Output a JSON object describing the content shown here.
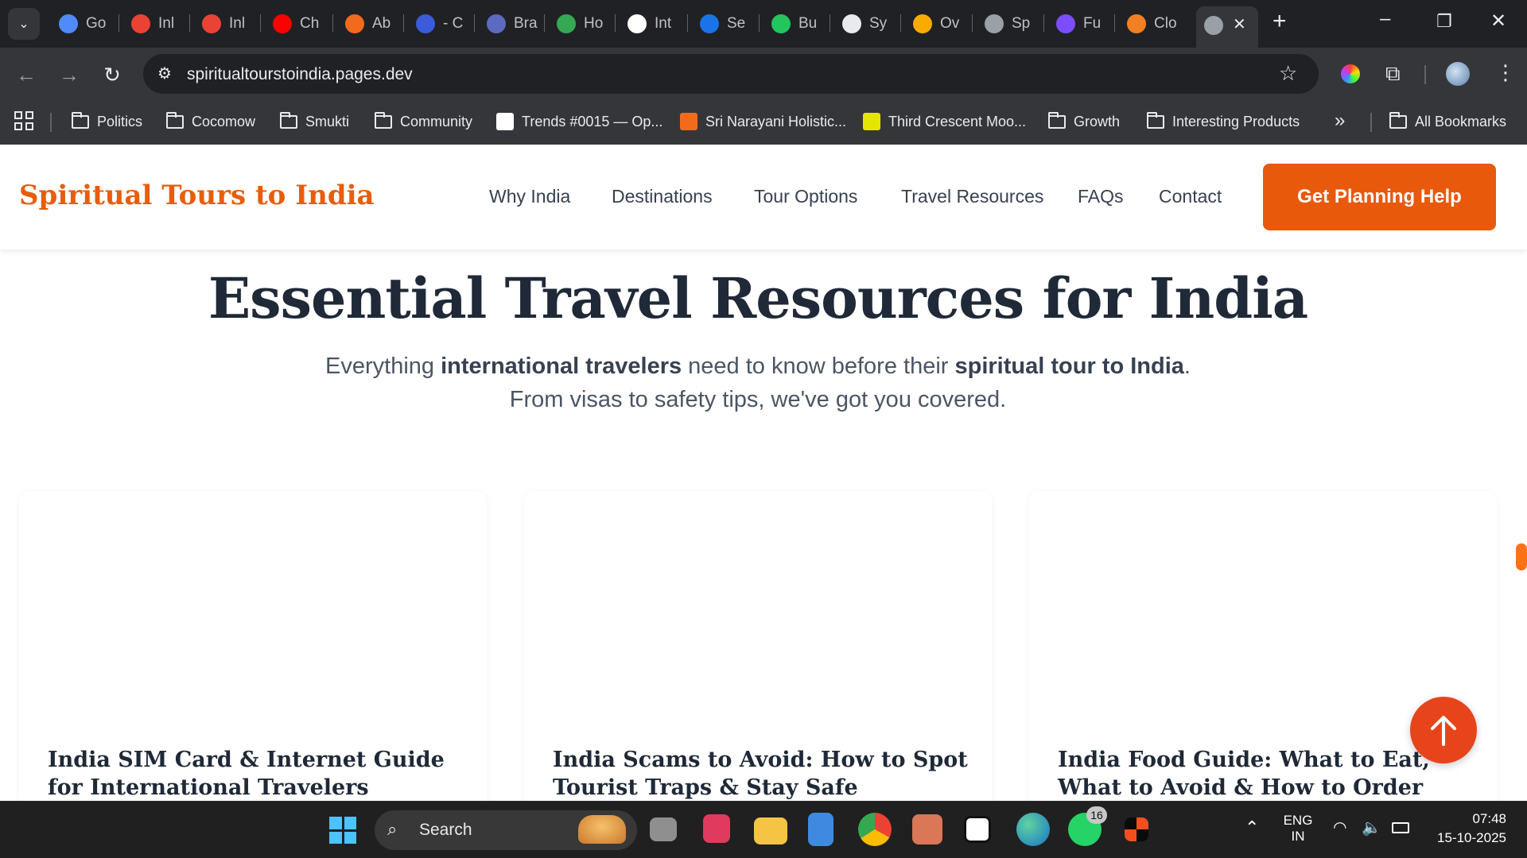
{
  "browser": {
    "tabs": [
      {
        "label": "Go",
        "icon": "gemini-icon",
        "color": "#4f8bf9"
      },
      {
        "label": "Inl",
        "icon": "gmail-icon",
        "color": "#ea4335"
      },
      {
        "label": "Inl",
        "icon": "gmail-icon",
        "color": "#ea4335"
      },
      {
        "label": "Ch",
        "icon": "youtube-icon",
        "color": "#ff0000"
      },
      {
        "label": "Ab",
        "icon": "orange-leaf-icon",
        "color": "#f26b1d"
      },
      {
        "label": "- C",
        "icon": "c-logo-icon",
        "color": "#3b5bdb"
      },
      {
        "label": "Bra",
        "icon": "book-icon",
        "color": "#5c6bc0"
      },
      {
        "label": "Ho",
        "icon": "drive-icon",
        "color": "#34a853"
      },
      {
        "label": "Int",
        "icon": "broadcast-icon",
        "color": "#ffffff"
      },
      {
        "label": "Se",
        "icon": "c-circle-icon",
        "color": "#1a73e8"
      },
      {
        "label": "Bu",
        "icon": "bolt-icon",
        "color": "#22c55e"
      },
      {
        "label": "Sy",
        "icon": "openai-icon",
        "color": "#e8eaed"
      },
      {
        "label": "Ov",
        "icon": "analytics-icon",
        "color": "#f9ab00"
      },
      {
        "label": "Sp",
        "icon": "globe-icon",
        "color": "#9aa0a6"
      },
      {
        "label": "Fu",
        "icon": "diamond-icon",
        "color": "#7c4dff"
      },
      {
        "label": "Clo",
        "icon": "cloudflare-icon",
        "color": "#f38020"
      }
    ],
    "new_tab": "+",
    "window": {
      "minimize": "–",
      "restore": "❐",
      "close": "✕"
    },
    "url": "spiritualtourstoindia.pages.dev",
    "bookmarks": [
      {
        "label": "Politics",
        "type": "folder"
      },
      {
        "label": "Cocomow",
        "type": "folder"
      },
      {
        "label": "Smukti",
        "type": "folder"
      },
      {
        "label": "Community",
        "type": "folder"
      },
      {
        "label": "Trends #0015 — Op...",
        "type": "site"
      },
      {
        "label": "Sri Narayani Holistic...",
        "type": "site"
      },
      {
        "label": "Third Crescent Moo...",
        "type": "site"
      },
      {
        "label": "Growth",
        "type": "folder"
      },
      {
        "label": "Interesting Products",
        "type": "folder"
      }
    ],
    "bookmarks_more": "»",
    "all_bookmarks": "All Bookmarks"
  },
  "site": {
    "logo": "Spiritual Tours to India",
    "nav": [
      "Why India",
      "Destinations",
      "Tour Options",
      "Travel Resources",
      "FAQs",
      "Contact"
    ],
    "cta": "Get Planning Help",
    "hero": {
      "title": "Essential Travel Resources for India",
      "sub_1": "Everything ",
      "sub_2": "international travelers",
      "sub_3": " need to know before their ",
      "sub_4": "spiritual tour to India",
      "sub_5": ".",
      "sub_6": "From visas to safety tips, we've got you covered."
    },
    "cards": [
      {
        "title": "India SIM Card & Internet Guide for International Travelers"
      },
      {
        "title": "India Scams to Avoid: How to Spot Tourist Traps & Stay Safe"
      },
      {
        "title": "India Food Guide: What to Eat, What to Avoid & How to Order"
      }
    ]
  },
  "taskbar": {
    "search_placeholder": "Search",
    "whatsapp_badge": "16",
    "lang_1": "ENG",
    "lang_2": "IN",
    "time": "07:48",
    "date": "15-10-2025"
  },
  "colors": {
    "accent": "#e8590c",
    "brand": "#e85d0c",
    "chrome_dark": "#202124"
  }
}
